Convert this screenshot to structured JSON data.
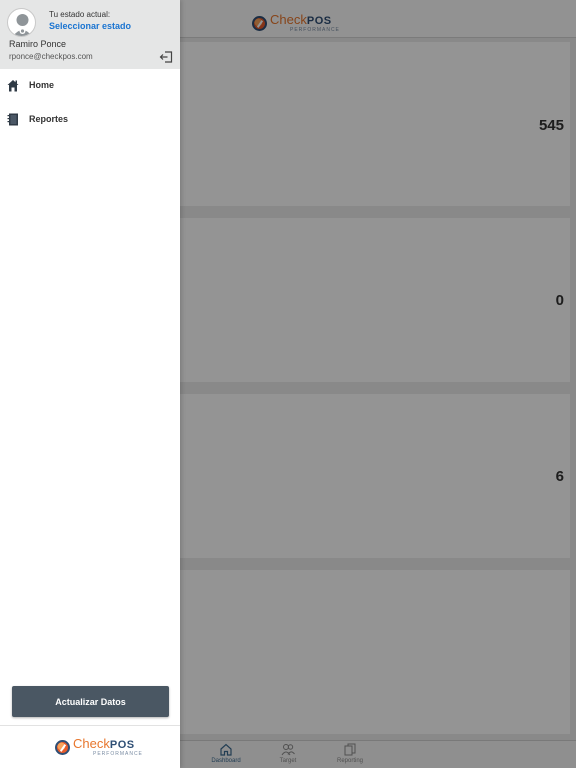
{
  "brand": {
    "name_part1": "Check",
    "name_part2": "POS",
    "tagline": "PERFORMANCE",
    "accent": "#e8772e",
    "primary": "#2f4f75"
  },
  "dashboard": {
    "cards": [
      {
        "value": "545"
      },
      {
        "value": "0"
      },
      {
        "value": "6"
      },
      {
        "value": ""
      }
    ]
  },
  "tabbar": {
    "tabs": [
      {
        "label": "Dashboard",
        "icon": "home-icon",
        "active": true
      },
      {
        "label": "Target",
        "icon": "people-icon",
        "active": false
      },
      {
        "label": "Reporting",
        "icon": "documents-icon",
        "active": false
      }
    ]
  },
  "drawer": {
    "status_caption": "Tu estado actual:",
    "status_link": "Seleccionar estado",
    "user_name": "Ramiro Ponce",
    "user_email": "rponce@checkpos.com",
    "nav": [
      {
        "label": "Home",
        "icon": "home-icon"
      },
      {
        "label": "Reportes",
        "icon": "notebook-icon"
      }
    ],
    "update_button": "Actualizar Datos",
    "status_link_color": "#1a74d1",
    "button_color": "#4a5763"
  }
}
